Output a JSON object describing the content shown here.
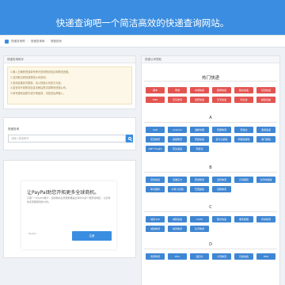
{
  "header": {
    "title": "快递查询吧一个简洁高效的快递查询网站。"
  },
  "breadcrumb": {
    "items": [
      "快递查询吧",
      "快递查询网",
      "快递查询"
    ]
  },
  "tips_panel": {
    "title": "快递查询助手",
    "lines": [
      "1.输入正确的快递单号即可查询物流信息和物流进度。",
      "2.支持数百家快递物流公司查询。",
      "3.查询结果实时更新，请以快递公司官方为准。",
      "4.如查询不到物流信息请稍后再试或联系快递公司。",
      "5.单号通常由数字或字母组成，请检查后再输入。"
    ]
  },
  "search_panel": {
    "label": "快递查询",
    "placeholder": "请输入快递单号",
    "button_icon": "search-icon"
  },
  "ad": {
    "title": "让PayPal助您开拓更多全球商机。",
    "description": "只需一个PayPal账户，您的跨境生意便能覆盖全球200多个国家和地区，让全球的买家都能轻松付款。",
    "brand": "PayPal",
    "button": "注册"
  },
  "directory": {
    "title": "快递公司导航",
    "hot": {
      "title": "热门快递",
      "rows": [
        [
          "顺丰",
          "申通",
          "中通快递",
          "圆通快递",
          "韵达快递",
          "百世快递"
        ],
        [
          "EMS",
          "京东物流",
          "德邦快递",
          "天天快递",
          "宅急送",
          "邮政包裹"
        ]
      ]
    },
    "sections": [
      {
        "letter": "A",
        "rows": [
          [
            "AAE",
            "Aramex",
            "澳邮中国",
            "安能物流",
            "安信达",
            "澳通速递"
          ],
          [
            "安迅物流",
            "奥硕物流",
            "安捷快递",
            "爱尔兰邮政",
            "阿根廷邮政",
            "澳门邮政"
          ],
          [
            "ABF Freight",
            "安达速递",
            "安鲜达"
          ]
        ]
      },
      {
        "letter": "B",
        "rows": [
          [
            "百世快运",
            "百福东方",
            "邦送物流",
            "宝凯物流",
            "贝海国际",
            "比利时邮政"
          ],
          [
            "笨鸟国际",
            "北青小红帽",
            "巴西邮政",
            "百腾物流"
          ]
        ]
      },
      {
        "letter": "C",
        "rows": [
          [
            "城市100",
            "城际快递",
            "CCES",
            "程光快递",
            "重庆星程",
            "传喜物流"
          ],
          [
            "城铁物流",
            "春风物流",
            "长宇物流"
          ]
        ]
      },
      {
        "letter": "D",
        "rows": [
          [
            "德邦物流",
            "DHL",
            "递四方",
            "大田物流",
            "东骏快捷",
            "DPD"
          ]
        ]
      }
    ]
  }
}
